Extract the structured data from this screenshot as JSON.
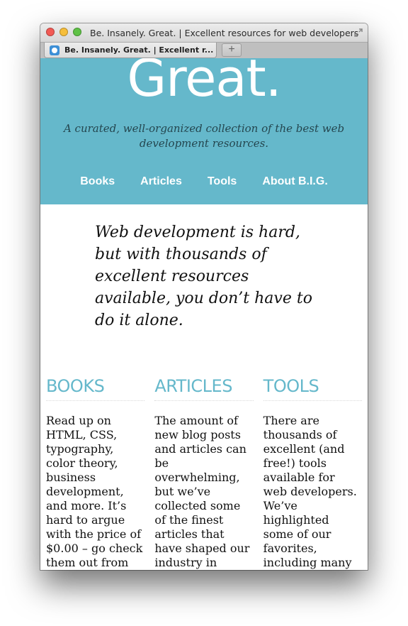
{
  "window": {
    "title": "Be. Insanely. Great. | Excellent resources for web developers",
    "tab_label": "Be. Insanely. Great. | Excellent r...",
    "new_tab_symbol": "+"
  },
  "site": {
    "title": "Great.",
    "tagline": "A curated, well-organized collection of the best web development resources.",
    "nav": [
      {
        "label": "Books"
      },
      {
        "label": "Articles"
      },
      {
        "label": "Tools"
      },
      {
        "label": "About B.I.G."
      }
    ],
    "intro": "Web development is hard, but with thousands of excellent resources available, you don’t have to do it alone."
  },
  "sections": [
    {
      "heading": "BOOKS",
      "text": "Read up on HTML, CSS, typography, color theory, business development, and more. It’s hard to argue with the price of $0.00 – go check them out from"
    },
    {
      "heading": "ARTICLES",
      "text": "The amount of new blog posts and articles can be overwhelming, but we’ve collected some of the finest articles that have shaped our industry in"
    },
    {
      "heading": "TOOLS",
      "text": "There are thousands of excellent (and free!) tools available for web developers. We’ve highlighted some of our favorites, including many"
    }
  ],
  "colors": {
    "accent": "#65b8cb",
    "tagline_text": "#24464f"
  },
  "icons": [
    "close-icon",
    "minimize-icon",
    "zoom-icon",
    "expand-icon",
    "favicon-icon",
    "plus-icon"
  ]
}
